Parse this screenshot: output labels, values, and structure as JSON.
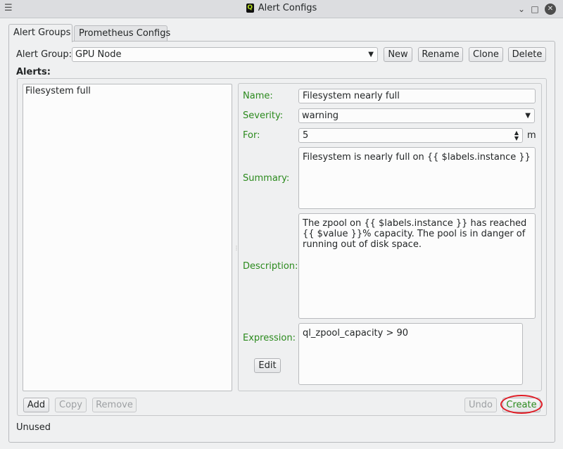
{
  "window": {
    "title": "Alert Configs",
    "app_icon_letter": "Q",
    "menu_icon": "hamburger-menu-icon",
    "controls": {
      "minimize": "⌄",
      "maximize": "□",
      "close": "✕"
    }
  },
  "tabs": [
    {
      "label": "Alert Groups",
      "active": true
    },
    {
      "label": "Prometheus Configs",
      "active": false
    }
  ],
  "group_bar": {
    "label": "Alert Group:",
    "selected": "GPU Node",
    "buttons": {
      "new": "New",
      "rename": "Rename",
      "clone": "Clone",
      "delete": "Delete"
    }
  },
  "alerts": {
    "heading": "Alerts:",
    "items": [
      "Filesystem full"
    ],
    "buttons": {
      "add": "Add",
      "copy": "Copy",
      "remove": "Remove"
    }
  },
  "detail": {
    "name": {
      "label": "Name:",
      "value": "Filesystem nearly full"
    },
    "severity": {
      "label": "Severity:",
      "value": "warning"
    },
    "for": {
      "label": "For:",
      "value": "5",
      "unit": "m"
    },
    "summary": {
      "label": "Summary:",
      "value": "Filesystem is nearly full on {{ $labels.instance }}"
    },
    "description": {
      "label": "Description:",
      "value": "The zpool on {{ $labels.instance }} has reached {{ $value }}% capacity. The pool is in danger of running out of disk space."
    },
    "expression": {
      "label": "Expression:",
      "value": "ql_zpool_capacity > 90",
      "edit_label": "Edit"
    }
  },
  "footer": {
    "undo": "Undo",
    "create": "Create",
    "status": "Unused"
  },
  "colors": {
    "field_label": "#2b8a1d",
    "highlight": "#e01b24",
    "background": "#eff0f1"
  }
}
